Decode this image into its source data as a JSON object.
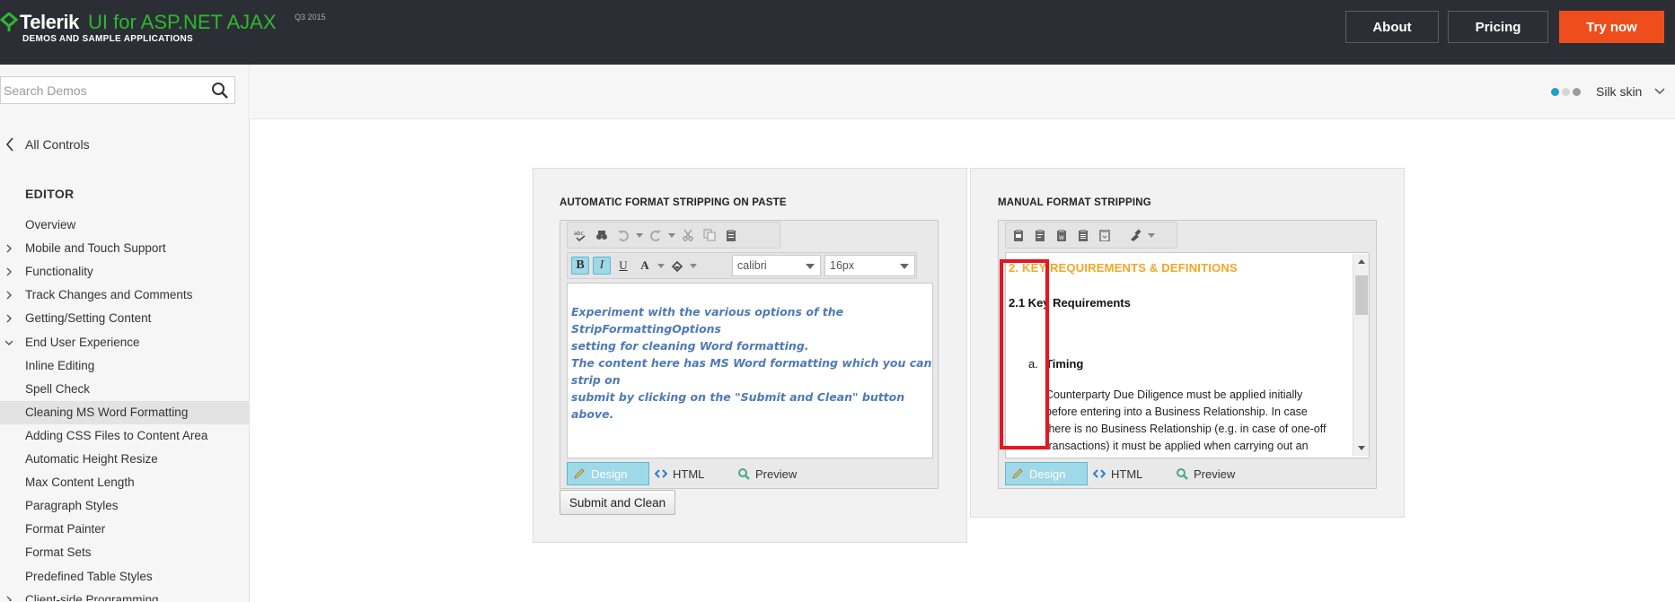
{
  "header": {
    "brand_name": "Telerik",
    "product": "UI for ASP.NET AJAX",
    "version": "Q3 2015",
    "subtitle": "DEMOS AND SAMPLE APPLICATIONS",
    "about": "About",
    "pricing": "Pricing",
    "try_now": "Try now",
    "colors": {
      "bg": "#2b2f35",
      "green": "#2eb82e",
      "orange": "#ee4e1b"
    }
  },
  "sidebar": {
    "search_placeholder": "Search Demos",
    "all_controls": "All Controls",
    "section_title": "EDITOR",
    "items": [
      {
        "label": "Overview",
        "expander": "none"
      },
      {
        "label": "Mobile and Touch Support",
        "expander": "collapsed"
      },
      {
        "label": "Functionality",
        "expander": "collapsed"
      },
      {
        "label": "Track Changes and Comments",
        "expander": "collapsed"
      },
      {
        "label": "Getting/Setting Content",
        "expander": "collapsed"
      },
      {
        "label": "End User Experience",
        "expander": "expanded"
      },
      {
        "label": "Inline Editing",
        "expander": "none"
      },
      {
        "label": "Spell Check",
        "expander": "none"
      },
      {
        "label": "Cleaning MS Word Formatting",
        "expander": "none",
        "active": true
      },
      {
        "label": "Adding CSS Files to Content Area",
        "expander": "none"
      },
      {
        "label": "Automatic Height Resize",
        "expander": "none"
      },
      {
        "label": "Max Content Length",
        "expander": "none"
      },
      {
        "label": "Paragraph Styles",
        "expander": "none"
      },
      {
        "label": "Format Painter",
        "expander": "none"
      },
      {
        "label": "Format Sets",
        "expander": "none"
      },
      {
        "label": "Predefined Table Styles",
        "expander": "none"
      },
      {
        "label": "Client-side Programming",
        "expander": "collapsed"
      }
    ]
  },
  "topbar": {
    "skin": "Silk skin",
    "dot_colors": [
      "#1fa0c9",
      "#d6d6d6",
      "#9c9c9c"
    ]
  },
  "left_panel": {
    "title": "AUTOMATIC FORMAT STRIPPING ON PASTE",
    "font_name": "calibri",
    "font_size": "16px",
    "content_line1": "Experiment with the various options of the StripFormattingOptions",
    "content_line2": "setting for cleaning Word formatting.",
    "content_line3": "The content here has MS Word formatting which you can strip on",
    "content_line4": "submit by clicking on the \"Submit and Clean\" button above.",
    "modes": {
      "design": "Design",
      "html": "HTML",
      "preview": "Preview"
    },
    "submit": "Submit and Clean"
  },
  "right_panel": {
    "title": "MANUAL FORMAT STRIPPING",
    "heading": "2. KEY REQUIREMENTS & DEFINITIONS",
    "subheading": "2.1 Key Requirements",
    "list_marker": "a.",
    "list_title": "Timing",
    "para_line1": "Counterparty Due Diligence must be applied initially",
    "para_line2": "before entering into a Business Relationship. In case",
    "para_line3": "there is no Business Relationship (e.g. in case of one-off",
    "para_line4": "transactions) it must be applied when carrying out an",
    "modes": {
      "design": "Design",
      "html": "HTML",
      "preview": "Preview"
    }
  },
  "accent": {
    "highlight": "#9fd9e8",
    "annotation": "#e8141f",
    "heading_orange": "#f5a623"
  }
}
